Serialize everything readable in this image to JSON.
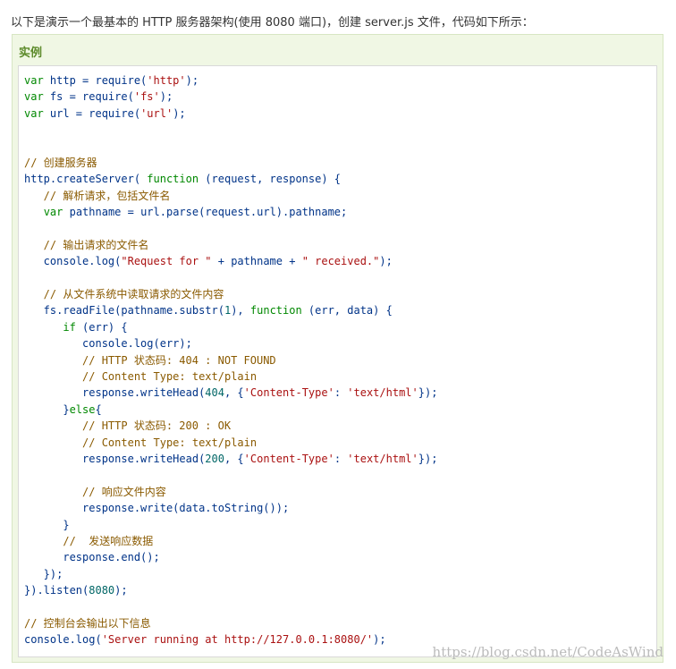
{
  "intro": "以下是演示一个最基本的 HTTP 服务器架构(使用 8080 端口)，创建 server.js 文件，代码如下所示：",
  "example": {
    "title": "实例",
    "code_lines": [
      [
        {
          "t": "var",
          "c": "kw"
        },
        {
          "t": " http = require(",
          "c": "plain"
        },
        {
          "t": "'http'",
          "c": "str"
        },
        {
          "t": ");",
          "c": "plain"
        }
      ],
      [
        {
          "t": "var",
          "c": "kw"
        },
        {
          "t": " fs = require(",
          "c": "plain"
        },
        {
          "t": "'fs'",
          "c": "str"
        },
        {
          "t": ");",
          "c": "plain"
        }
      ],
      [
        {
          "t": "var",
          "c": "kw"
        },
        {
          "t": " url = require(",
          "c": "plain"
        },
        {
          "t": "'url'",
          "c": "str"
        },
        {
          "t": ");",
          "c": "plain"
        }
      ],
      [],
      [],
      [
        {
          "t": "// 创建服务器",
          "c": "cmt"
        }
      ],
      [
        {
          "t": "http.createServer( ",
          "c": "plain"
        },
        {
          "t": "function",
          "c": "kw"
        },
        {
          "t": " (request, response) {",
          "c": "plain"
        }
      ],
      [
        {
          "t": "   // 解析请求，包括文件名",
          "c": "cmt"
        }
      ],
      [
        {
          "t": "   ",
          "c": "plain"
        },
        {
          "t": "var",
          "c": "kw"
        },
        {
          "t": " pathname = url.parse(request.url).pathname;",
          "c": "plain"
        }
      ],
      [],
      [
        {
          "t": "   // 输出请求的文件名",
          "c": "cmt"
        }
      ],
      [
        {
          "t": "   console.log(",
          "c": "plain"
        },
        {
          "t": "\"Request for \"",
          "c": "str"
        },
        {
          "t": " + pathname + ",
          "c": "plain"
        },
        {
          "t": "\" received.\"",
          "c": "str"
        },
        {
          "t": ");",
          "c": "plain"
        }
      ],
      [],
      [
        {
          "t": "   // 从文件系统中读取请求的文件内容",
          "c": "cmt"
        }
      ],
      [
        {
          "t": "   fs.readFile(pathname.substr(",
          "c": "plain"
        },
        {
          "t": "1",
          "c": "num"
        },
        {
          "t": "), ",
          "c": "plain"
        },
        {
          "t": "function",
          "c": "kw"
        },
        {
          "t": " (err, data) {",
          "c": "plain"
        }
      ],
      [
        {
          "t": "      ",
          "c": "plain"
        },
        {
          "t": "if",
          "c": "kw"
        },
        {
          "t": " (err) {",
          "c": "plain"
        }
      ],
      [
        {
          "t": "         console.log(err);",
          "c": "plain"
        }
      ],
      [
        {
          "t": "         // HTTP 状态码: 404 : NOT FOUND",
          "c": "cmt"
        }
      ],
      [
        {
          "t": "         // Content Type: text/plain",
          "c": "cmt"
        }
      ],
      [
        {
          "t": "         response.writeHead(",
          "c": "plain"
        },
        {
          "t": "404",
          "c": "num"
        },
        {
          "t": ", {",
          "c": "plain"
        },
        {
          "t": "'Content-Type'",
          "c": "str"
        },
        {
          "t": ": ",
          "c": "plain"
        },
        {
          "t": "'text/html'",
          "c": "str"
        },
        {
          "t": "});",
          "c": "plain"
        }
      ],
      [
        {
          "t": "      }",
          "c": "plain"
        },
        {
          "t": "else",
          "c": "kw"
        },
        {
          "t": "{",
          "c": "plain"
        }
      ],
      [
        {
          "t": "         // HTTP 状态码: 200 : OK",
          "c": "cmt"
        }
      ],
      [
        {
          "t": "         // Content Type: text/plain",
          "c": "cmt"
        }
      ],
      [
        {
          "t": "         response.writeHead(",
          "c": "plain"
        },
        {
          "t": "200",
          "c": "num"
        },
        {
          "t": ", {",
          "c": "plain"
        },
        {
          "t": "'Content-Type'",
          "c": "str"
        },
        {
          "t": ": ",
          "c": "plain"
        },
        {
          "t": "'text/html'",
          "c": "str"
        },
        {
          "t": "});",
          "c": "plain"
        }
      ],
      [],
      [
        {
          "t": "         // 响应文件内容",
          "c": "cmt"
        }
      ],
      [
        {
          "t": "         response.write(data.toString());",
          "c": "plain"
        }
      ],
      [
        {
          "t": "      }",
          "c": "plain"
        }
      ],
      [
        {
          "t": "      //  发送响应数据",
          "c": "cmt"
        }
      ],
      [
        {
          "t": "      response.end();",
          "c": "plain"
        }
      ],
      [
        {
          "t": "   });",
          "c": "plain"
        }
      ],
      [
        {
          "t": "}).listen(",
          "c": "plain"
        },
        {
          "t": "8080",
          "c": "num"
        },
        {
          "t": ");",
          "c": "plain"
        }
      ],
      [],
      [
        {
          "t": "// 控制台会输出以下信息",
          "c": "cmt"
        }
      ],
      [
        {
          "t": "console.log(",
          "c": "plain"
        },
        {
          "t": "'Server running at http://127.0.0.1:8080/'",
          "c": "str"
        },
        {
          "t": ");",
          "c": "plain"
        }
      ]
    ]
  },
  "watermark": "https://blog.csdn.net/CodeAsWind"
}
